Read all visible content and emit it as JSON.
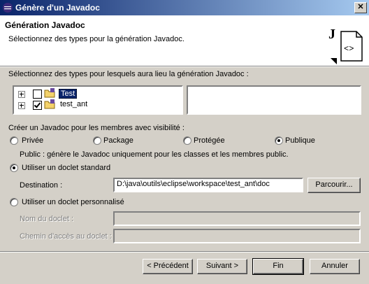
{
  "window": {
    "title": "Génère d'un Javadoc"
  },
  "banner": {
    "title": "Génération Javadoc",
    "description": "Sélectionnez des types pour la génération Javadoc."
  },
  "types": {
    "label": "Sélectionnez des types pour lesquels aura lieu la génération Javadoc :",
    "tree": [
      {
        "label": "Test",
        "checked": false,
        "selected": true
      },
      {
        "label": "test_ant",
        "checked": true,
        "selected": false
      }
    ]
  },
  "visibility": {
    "label": "Créer un Javadoc pour les membres avec visibilité :",
    "options": [
      "Privée",
      "Package",
      "Protégée",
      "Publique"
    ],
    "selected": "Publique",
    "hint": "Public : génère le Javadoc uniquement pour les classes et les membres public."
  },
  "doclet": {
    "standard_label": "Utiliser un doclet standard",
    "destination_label": "Destination :",
    "destination_value": "D:\\java\\outils\\eclipse\\workspace\\test_ant\\doc",
    "browse_label": "Parcourir...",
    "custom_label": "Utiliser un doclet personnalisé",
    "name_label": "Nom du doclet :",
    "path_label": "Chemin d'accès au doclet :",
    "name_value": "",
    "path_value": "",
    "selected": "standard"
  },
  "buttons": {
    "previous": "< Précédent",
    "next": "Suivant >",
    "finish": "Fin",
    "cancel": "Annuler"
  }
}
